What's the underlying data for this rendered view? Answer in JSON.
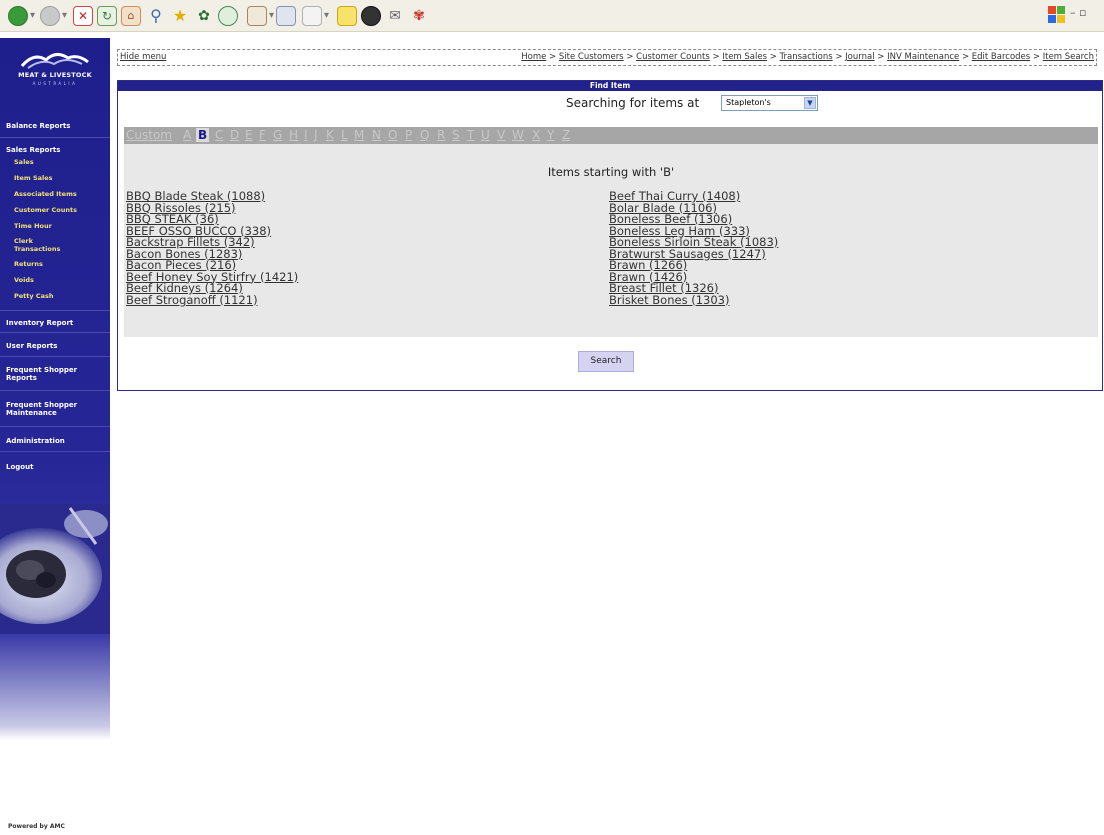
{
  "breadcrumb": {
    "hide_menu": "Hide menu",
    "items": [
      "Home",
      "Site Customers",
      "Customer Counts",
      "Item Sales",
      "Transactions",
      "Journal",
      "INV Maintenance",
      "Edit Barcodes",
      "Item Search"
    ],
    "separator": ">"
  },
  "sidebar": {
    "brand": "MEAT & LIVESTOCK",
    "brand_sub": "AUSTRALIA",
    "items": [
      {
        "label": "Balance Reports"
      },
      {
        "label": "Sales Reports"
      },
      {
        "label": "Sales"
      },
      {
        "label": "Item Sales"
      },
      {
        "label": "Associated Items"
      },
      {
        "label": "Customer Counts"
      },
      {
        "label": "Time Hour"
      },
      {
        "label": "Clerk Transactions"
      },
      {
        "label": "Returns"
      },
      {
        "label": "Voids"
      },
      {
        "label": "Petty Cash"
      },
      {
        "label": "Inventory Report"
      },
      {
        "label": "User Reports"
      },
      {
        "label": "Frequent Shopper Reports"
      },
      {
        "label": "Frequent Shopper Maintenance"
      },
      {
        "label": "Administration"
      },
      {
        "label": "Logout"
      }
    ],
    "footer": "Powered by AMC"
  },
  "panel": {
    "title": "Find Item",
    "search_label": "Searching for items at",
    "store_value": "Stapleton's",
    "letters": [
      "Custom",
      "A",
      "B",
      "C",
      "D",
      "E",
      "F",
      "G",
      "H",
      "I",
      "J",
      "K",
      "L",
      "M",
      "N",
      "O",
      "P",
      "Q",
      "R",
      "S",
      "T",
      "U",
      "V",
      "W",
      "X",
      "Y",
      "Z"
    ],
    "active_letter": "B",
    "results_heading": "Items starting with 'B'",
    "left_items": [
      "BBQ Blade Steak (1088)",
      "BBQ Rissoles (215)",
      "BBQ STEAK (36)",
      "BEEF OSSO BUCCO (338)",
      "Backstrap Fillets (342)",
      "Bacon Bones (1283)",
      "Bacon Pieces (216)",
      "Beef Honey Soy Stirfry (1421)",
      "Beef Kidneys (1264)",
      "Beef Stroganoff (1121)"
    ],
    "right_items": [
      "Beef Thai Curry (1408)",
      "Bolar Blade (1106)",
      "Boneless Beef (1306)",
      "Boneless Leg Ham (333)",
      "Boneless Sirloin Steak (1083)",
      "Bratwurst Sausages (1247)",
      "Brawn (1266)",
      "Brawn (1426)",
      "Breast Fillet (1326)",
      "Brisket Bones (1303)"
    ],
    "search_button": "Search"
  }
}
